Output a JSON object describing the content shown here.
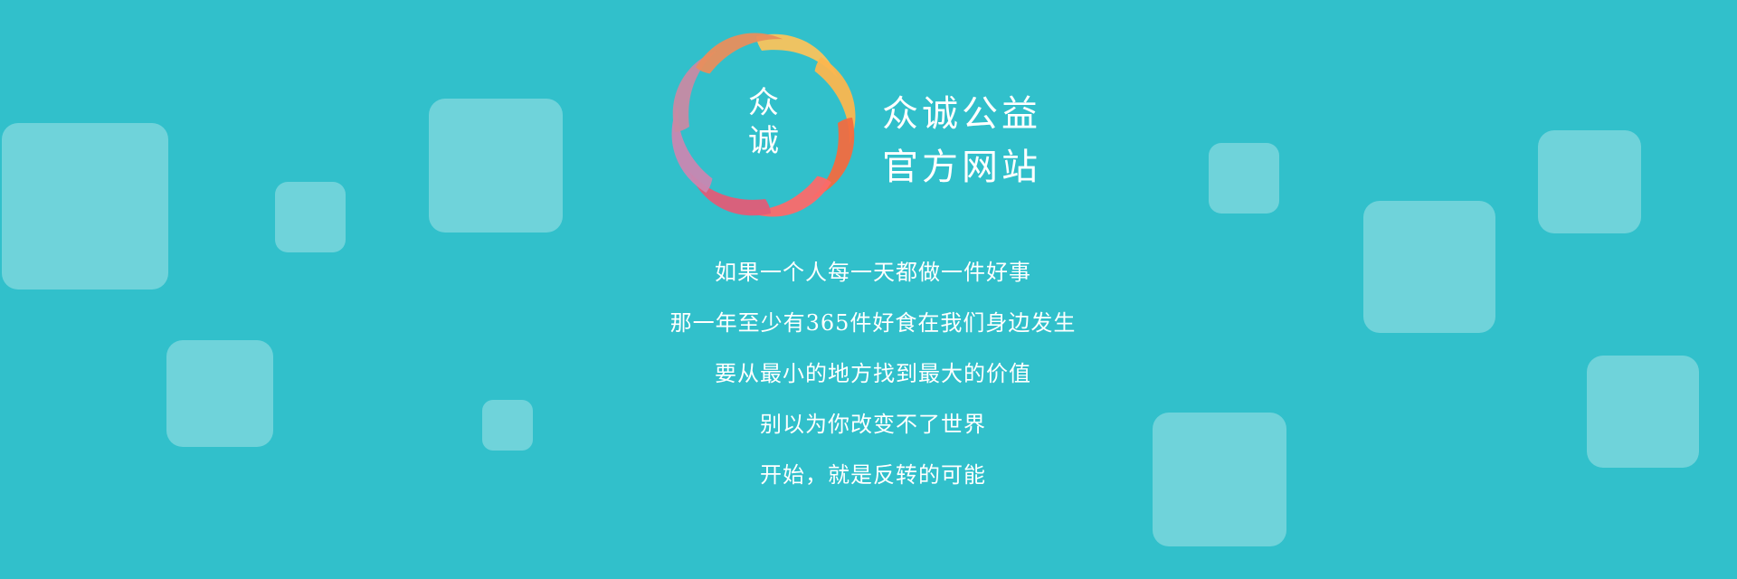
{
  "logo": {
    "char_top": "众",
    "char_bottom": "诚",
    "petal_colors": [
      "#f9c35c",
      "#fbb64e",
      "#f26b3f",
      "#fb6a6a",
      "#e15c77",
      "#c987b1",
      "#c88aa3",
      "#e88e5c"
    ]
  },
  "title": {
    "line1": "众诚公益",
    "line2": "官方网站"
  },
  "slogans": [
    "如果一个人每一天都做一件好事",
    "那一年至少有365件好食在我们身边发生",
    "要从最小的地方找到最大的价值",
    "别以为你改变不了世界",
    "开始，就是反转的可能"
  ],
  "colors": {
    "background": "#31c0cb",
    "square": "rgba(255,255,255,0.30)",
    "text": "#ffffff"
  }
}
